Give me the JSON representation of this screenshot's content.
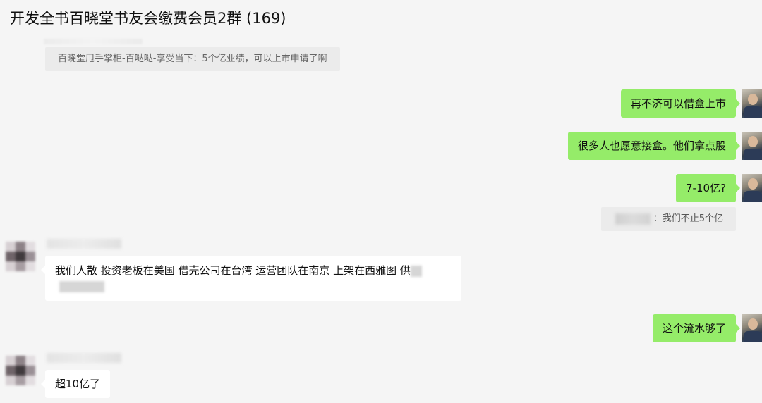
{
  "window": {
    "title": "开发全书百晓堂书友会缴费会员2群 (169)"
  },
  "messages": {
    "quote_top": "百晓堂甩手掌柜-百哒哒-享受当下：5个亿业绩，可以上市申请了啊",
    "me_1": "再不济可以借盒上市",
    "me_2": "很多人也愿意接盒。他们拿点股",
    "me_3": "7-10亿?",
    "quote_right": "：我们不止5个亿",
    "other_1": "我们人散 投资老板在美国 借壳公司在台湾 运营团队在南京 上架在西雅图 供",
    "me_4": "这个流水够了",
    "other_2": "超10亿了"
  },
  "colors": {
    "bubble_self": "#95ec69",
    "bubble_other": "#ffffff",
    "background": "#f5f5f5"
  }
}
